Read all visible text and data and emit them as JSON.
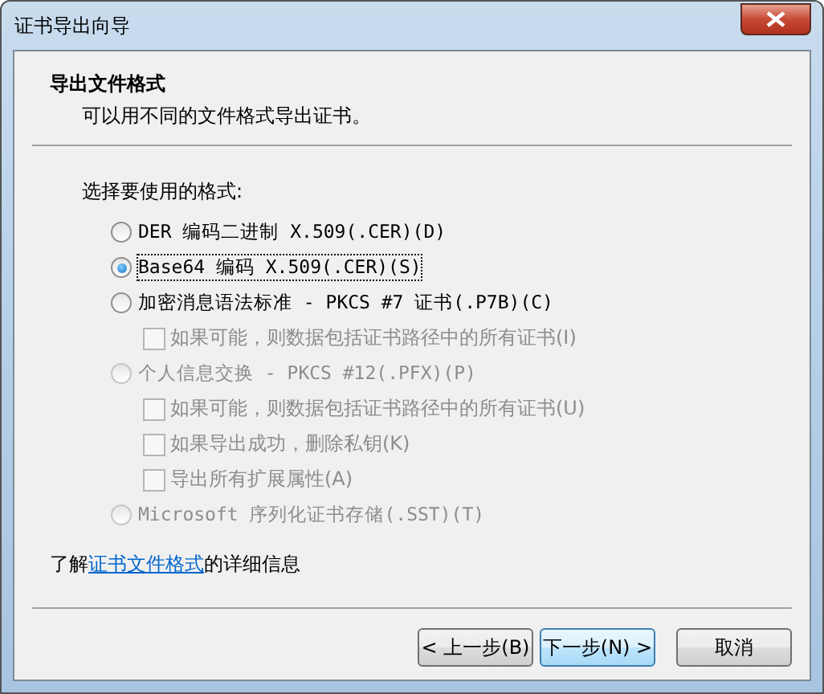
{
  "window": {
    "title": "证书导出向导"
  },
  "header": {
    "title": "导出文件格式",
    "subtitle": "可以用不同的文件格式导出证书。"
  },
  "prompt": "选择要使用的格式:",
  "options": [
    {
      "label": "DER 编码二进制 X.509(.CER)(D)",
      "selected": false,
      "disabled": false
    },
    {
      "label": "Base64 编码 X.509(.CER)(S)",
      "selected": true,
      "disabled": false
    },
    {
      "label": "加密消息语法标准 - PKCS #7 证书(.P7B)(C)",
      "selected": false,
      "disabled": false,
      "children": [
        {
          "label": "如果可能，则数据包括证书路径中的所有证书(I)",
          "checked": false,
          "disabled": true
        }
      ]
    },
    {
      "label": "个人信息交换 - PKCS #12(.PFX)(P)",
      "selected": false,
      "disabled": true,
      "children": [
        {
          "label": "如果可能，则数据包括证书路径中的所有证书(U)",
          "checked": false,
          "disabled": true
        },
        {
          "label": "如果导出成功，删除私钥(K)",
          "checked": false,
          "disabled": true
        },
        {
          "label": "导出所有扩展属性(A)",
          "checked": false,
          "disabled": true
        }
      ]
    },
    {
      "label": "Microsoft 序列化证书存储(.SST)(T)",
      "selected": false,
      "disabled": true
    }
  ],
  "info": {
    "before": "了解",
    "link": "证书文件格式",
    "after": "的详细信息"
  },
  "buttons": [
    {
      "label": "< 上一步(B)",
      "default": false
    },
    {
      "label": "下一步(N) >",
      "default": true
    },
    {
      "label": "取消",
      "default": false
    }
  ]
}
